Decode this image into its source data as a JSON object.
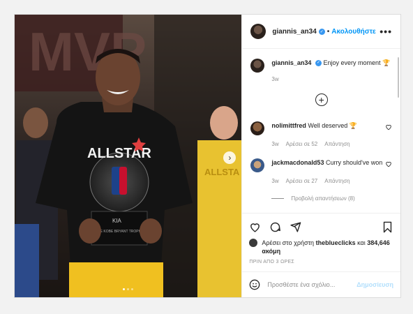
{
  "post": {
    "username": "giannis_an34",
    "separator": "•",
    "follow_label": "Ακολουθήστε",
    "more_label": "•••",
    "caption_text": "Enjoy every moment 🏆",
    "caption_time": "3w",
    "load_more_icon": "plus-circle-icon",
    "comments": [
      {
        "username": "nolimittfred",
        "text": "Well deserved 🏆",
        "time": "3w",
        "likes": "Αρέσει σε 52",
        "reply": "Απάντηση"
      },
      {
        "username": "jackmacdonald53",
        "text": "Curry should've won",
        "time": "3w",
        "likes": "Αρέσει σε 27",
        "reply": "Απάντηση",
        "view_replies": "Προβολή απαντήσεων (8)"
      }
    ],
    "likes_prefix": "Αρέσει στο χρήστη",
    "likes_user": "theblueclicks",
    "likes_and": "και",
    "likes_count": "384,646 ακόμη",
    "timestamp": "ΠΡΙΝ ΑΠΟ 3 ΩΡΕΣ",
    "comment_placeholder": "Προσθέστε ένα σχόλιο...",
    "post_button": "Δημοσίευση",
    "accent": "#0095f6",
    "slide_count": 3,
    "active_slide": 1
  },
  "photo": {
    "banner_text": "MVP",
    "jersey_text": "ALLSTAR",
    "background_jersey_text": "ALLSTA",
    "trophy_text": "KIA",
    "trophy_plaque": "THE KOBE BRYANT TROPHY"
  }
}
